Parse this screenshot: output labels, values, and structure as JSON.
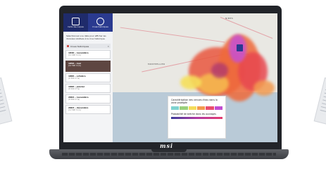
{
  "sidebar": {
    "modes": [
      {
        "label": "Carte des risques",
        "icon": "map-icon"
      },
      {
        "label": "Crues historiques",
        "icon": "history-icon"
      }
    ],
    "intro": "Sélectionnez une date pour afficher les données relatives à la crue historique.",
    "panel_title": "Crues historiques",
    "floods": [
      {
        "title": "1840 - novembre",
        "volume": "(11 000 m³/s)"
      },
      {
        "title": "1856 - mai",
        "volume": "(12 500 m³/s)"
      },
      {
        "title": "1886 - octobre",
        "volume": "(9 300 m³/s)"
      },
      {
        "title": "1996 - janvier",
        "volume": "(8 500 m³/s)"
      },
      {
        "title": "2002 - novembre",
        "volume": "(8 500 m³/s)"
      },
      {
        "title": "2003 - décembre",
        "volume": "(11 500 m³/s)"
      }
    ],
    "selected_index": 1
  },
  "map": {
    "cities": [
      "NIMES",
      "MONTPELLIER",
      "ARLES"
    ]
  },
  "legend": {
    "title": "Caractérisation des venues d'eau dans la zone protégée",
    "swatch_colors": [
      "#7fd3d0",
      "#9ad07b",
      "#f4dc5a",
      "#f39a4e",
      "#e94e6d",
      "#c14dd1"
    ],
    "breach_title": "Probabilité de brèche dans les ouvrages"
  },
  "laptop": {
    "brand": "msi"
  }
}
